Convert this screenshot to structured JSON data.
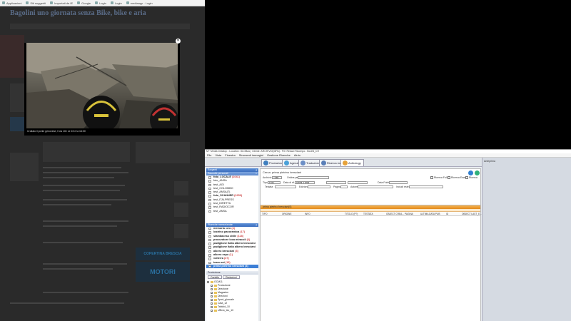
{
  "browser": {
    "bookmarks": [
      "Applicazioni",
      "Siti suggeriti",
      "Importati da IE",
      "Google",
      "Login",
      "Login",
      "mediaapp - Login"
    ],
    "site_headline": "Bagolini uno giornata senza Bike, bike e aria",
    "modal": {
      "caption": "Crollato il ponte genovese, l'ora 10e Le 15 e la 16:00"
    },
    "ads": {
      "ad1_text": "COPERTINA BRESCIA",
      "ad2_text": "MOTORI"
    }
  },
  "app": {
    "window_title": "M+ Media Desktop - Location: GLOBAL | Utente: ARCHIVIO(MPA) - Per Redazi Ricompo - BLIZB_CH",
    "menu": [
      "File",
      "Vista",
      "Finestra",
      "Strumenti immagini",
      "Gestione Ricerche",
      "Aiuto"
    ],
    "tabs": [
      "Produzione",
      "Agenzie",
      "Traduzione",
      "Ricerca manuali",
      "Anthology"
    ],
    "archive_panel": {
      "title": "Sorgenti",
      "header_row": "Raccolte personali",
      "items": [
        {
          "label": "foto_LOCALE",
          "count": "(1041)",
          "bold": true
        },
        {
          "label": "foto_ANSA",
          "count": "",
          "bold": false
        },
        {
          "label": "test_AGI",
          "count": "",
          "bold": false
        },
        {
          "label": "test_COLOMBO",
          "count": "",
          "bold": false
        },
        {
          "label": "test_ANSA(T)",
          "count": "",
          "bold": false
        },
        {
          "label": "foto_SCANNER",
          "count": "(2259)",
          "bold": true
        },
        {
          "label": "test_ITALPRESS",
          "count": "",
          "bold": false
        },
        {
          "label": "test_DIRETTA",
          "count": "",
          "bold": false
        },
        {
          "label": "test_RADIOCOR",
          "count": "",
          "bold": false
        },
        {
          "label": "test_ANSA",
          "count": "",
          "bold": false
        }
      ]
    },
    "searches_panel": {
      "title": "Ricerche memorizzate",
      "items": [
        {
          "label": "memoria: oro",
          "count": "(4)",
          "selected": false
        },
        {
          "label": "lostrino panoramica",
          "count": "(17)",
          "selected": false
        },
        {
          "label": "stambacesa civile",
          "count": "(118)",
          "selected": false
        },
        {
          "label": "procuratore luca miracoli",
          "count": "(6)",
          "selected": false
        },
        {
          "label": "padiglione Italia albero bresciani",
          "count": "",
          "selected": false
        },
        {
          "label": "padiglione Italia albero bresciani",
          "count": "",
          "selected": false
        },
        {
          "label": "albero bresciani",
          "count": "(3)",
          "selected": false
        },
        {
          "label": "albero expo",
          "count": "(1)",
          "selected": false
        },
        {
          "label": "volterra",
          "count": "(27)",
          "selected": false
        },
        {
          "label": "team out",
          "count": "(15)",
          "selected": false
        },
        {
          "label": "prima pietrino bresciani",
          "count": "(4)",
          "selected": true
        }
      ]
    },
    "production_panel": {
      "title": "Produzione",
      "subtabs": [
        "Cartelle",
        "Redazioni"
      ],
      "tree": [
        "GCM11",
        "Produzione",
        "Direzione",
        "Magazine",
        "Direzioni",
        "Sport_giornale",
        "Cata_12",
        "Tabloid_10",
        "Ufficio_tec_10"
      ]
    },
    "search_form": {
      "title": "Cerca: prima pietrino bresciani",
      "archivio_label": "Archivio",
      "archivio_value": "Tutto",
      "ordina_label": "Ordina per",
      "tipo_label": "Tipo",
      "tipo_value": "Foto",
      "data_label": "Data di rif.",
      "data_value": "Ultimi 3 anni",
      "testo_label": "Testata",
      "edizione_label": "Edizione",
      "pagina_label": "Pagina",
      "autore_label": "Autore",
      "data_pubbl_label": "Data Pubbl.",
      "ricerca_full_label": "Ricerca Full",
      "ricerca_esatta_label": "Ricerca Esatta",
      "includi_label": "Includi esterne",
      "ricerca_label": "Ricerca"
    },
    "results": {
      "header": "prima pietrino bresciani(0)",
      "columns": [
        "TIPO",
        "ORIGINE",
        "INFO",
        "TITOLO (P?)",
        "TESTATA",
        "OBJECT CREA...",
        "PAGINA",
        "ULTIMA DATA PUB",
        "ID",
        "OBJECT LAST_E..."
      ]
    },
    "anteprima_title": "Anteprima"
  }
}
